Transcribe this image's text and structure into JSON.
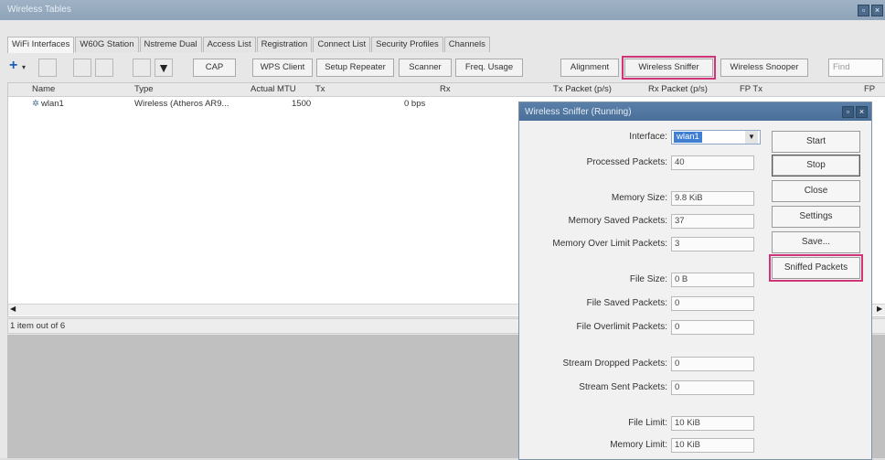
{
  "window": {
    "title": "Wireless Tables"
  },
  "tabs": [
    "WiFi Interfaces",
    "W60G Station",
    "Nstreme Dual",
    "Access List",
    "Registration",
    "Connect List",
    "Security Profiles",
    "Channels"
  ],
  "toolbar": {
    "add_label": "+",
    "cap": "CAP",
    "wps_client": "WPS Client",
    "setup_repeater": "Setup Repeater",
    "scanner": "Scanner",
    "freq_usage": "Freq. Usage",
    "alignment": "Alignment",
    "wireless_sniffer": "Wireless Sniffer",
    "wireless_snooper": "Wireless Snooper",
    "find_placeholder": "Find"
  },
  "table": {
    "columns": [
      "Name",
      "Type",
      "Actual MTU",
      "Tx",
      "Rx",
      "Tx Packet (p/s)",
      "Rx Packet (p/s)",
      "FP Tx",
      "FP"
    ],
    "rows": [
      {
        "name": "wlan1",
        "type": "Wireless (Atheros AR9...",
        "mtu": "1500",
        "tx": "0 bps"
      }
    ]
  },
  "status": {
    "count": "1 item out of 6"
  },
  "dialog": {
    "title": "Wireless Sniffer (Running)",
    "fields": [
      {
        "label": "Interface:",
        "value": "wlan1"
      },
      {
        "label": "Processed Packets:",
        "value": "40"
      },
      {
        "label": "Memory Size:",
        "value": "9.8 KiB"
      },
      {
        "label": "Memory Saved Packets:",
        "value": "37"
      },
      {
        "label": "Memory Over Limit Packets:",
        "value": "3"
      },
      {
        "label": "File Size:",
        "value": "0 B"
      },
      {
        "label": "File Saved Packets:",
        "value": "0"
      },
      {
        "label": "File Overlimit Packets:",
        "value": "0"
      },
      {
        "label": "Stream Dropped Packets:",
        "value": "0"
      },
      {
        "label": "Stream Sent Packets:",
        "value": "0"
      },
      {
        "label": "File Limit:",
        "value": "10 KiB"
      },
      {
        "label": "Memory Limit:",
        "value": "10 KiB"
      }
    ],
    "buttons": {
      "start": "Start",
      "stop": "Stop",
      "close": "Close",
      "settings": "Settings",
      "save": "Save...",
      "sniffed": "Sniffed Packets"
    }
  },
  "colors": {
    "highlight": "#d0357a",
    "titlebar": "#5a7fa8",
    "interface_selected": "#3f7fd4"
  }
}
